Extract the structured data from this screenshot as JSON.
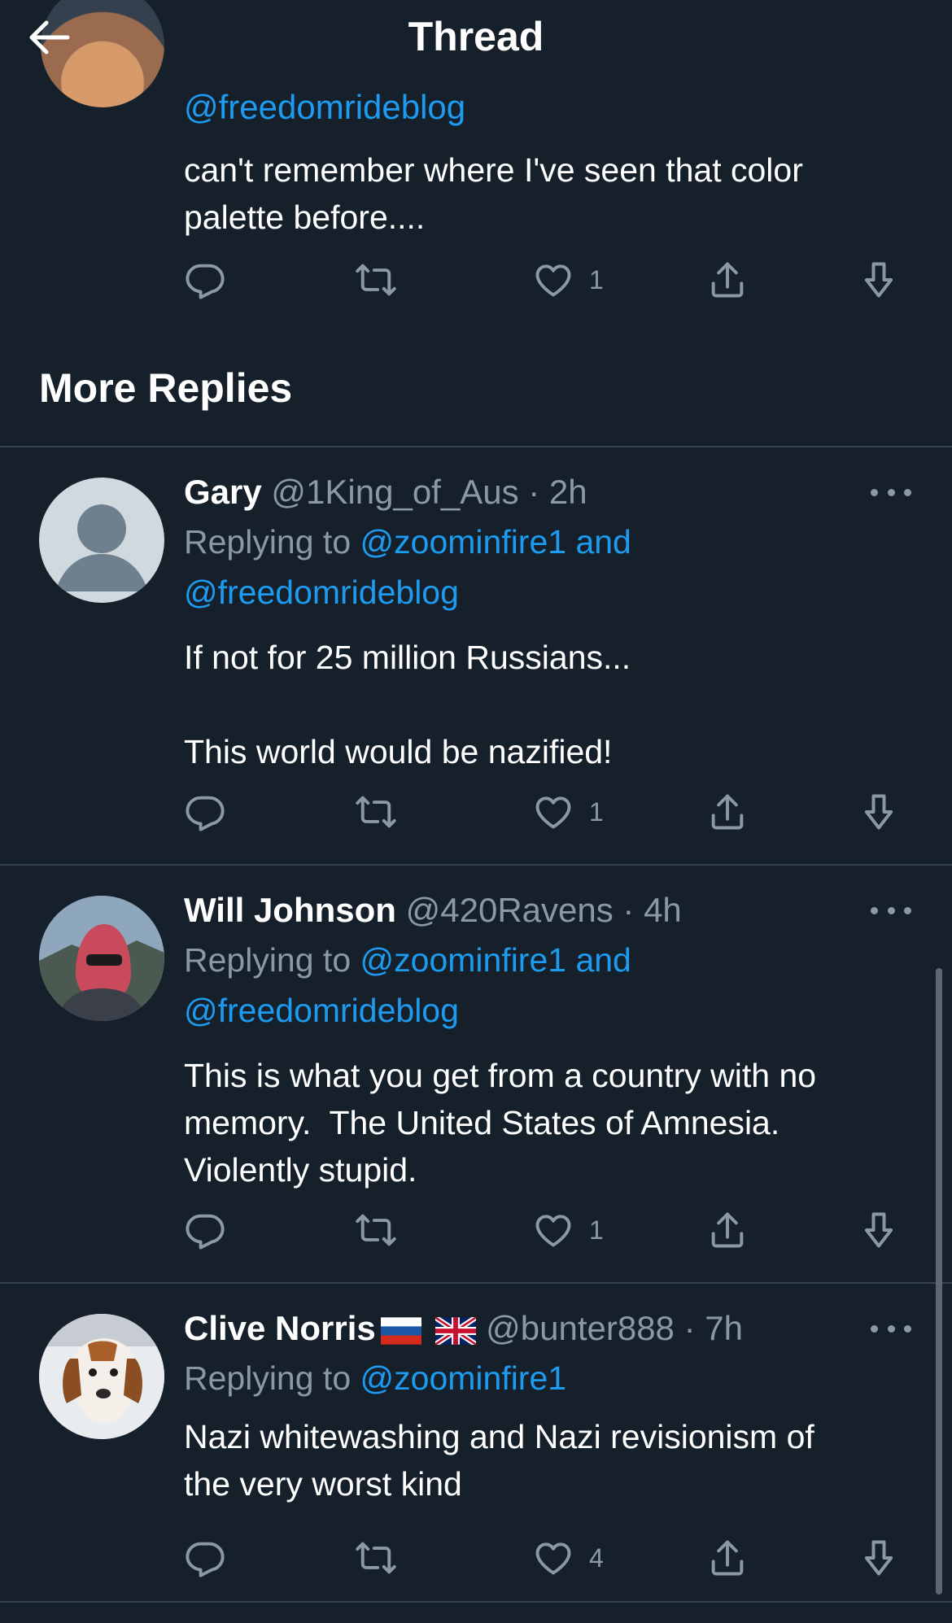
{
  "header": {
    "title": "Thread"
  },
  "top_tweet": {
    "handle": "@freedomrideblog",
    "text_line1": "can't remember where I've seen that color",
    "text_line2": "palette before....",
    "likes": "1"
  },
  "section_title": "More Replies",
  "replies": [
    {
      "name": "Gary",
      "handle": "@1King_of_Aus",
      "time": "· 2h",
      "replying_prefix": "Replying to ",
      "replying_to_1": "@zoominfire1 and",
      "replying_to_2": "@freedomrideblog",
      "text_line1": "If not for 25 million Russians...",
      "text_line2": "This world would be nazified!",
      "likes": "1"
    },
    {
      "name": "Will Johnson",
      "handle": "@420Ravens",
      "time": "· 4h",
      "replying_prefix": "Replying to ",
      "replying_to_1": "@zoominfire1 and",
      "replying_to_2": "@freedomrideblog",
      "text_line1": "This is what you get from a country with no",
      "text_line2": "memory.  The United States of Amnesia.",
      "text_line3": "Violently stupid.",
      "likes": "1"
    },
    {
      "name": "Clive Norris",
      "handle": "@bunter888",
      "time": "· 7h",
      "replying_prefix": "Replying to ",
      "replying_to_1": "@zoominfire1",
      "text_line1": "Nazi whitewashing and Nazi revisionism of",
      "text_line2": "the very worst kind",
      "likes": "4"
    }
  ],
  "colors": {
    "background": "#15202b",
    "accent": "#1d9bf0",
    "muted": "#8b98a5",
    "divider": "#38444d"
  },
  "icons": [
    "back-arrow-icon",
    "reply-icon",
    "retweet-icon",
    "like-icon",
    "share-icon",
    "download-icon",
    "more-icon"
  ]
}
